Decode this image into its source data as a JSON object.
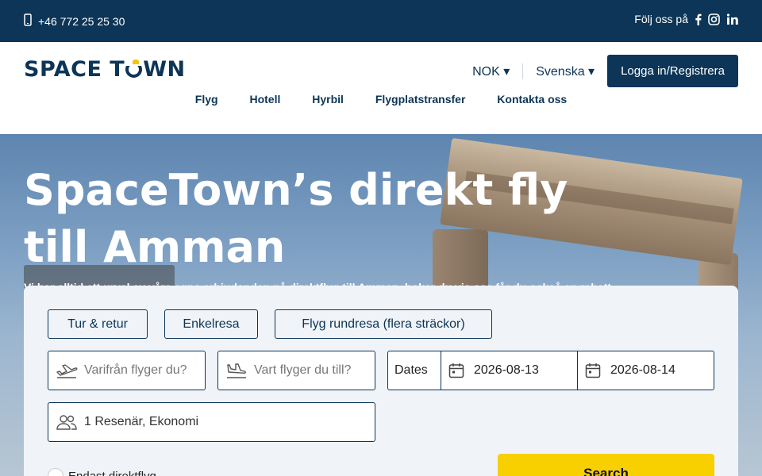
{
  "topbar": {
    "phone": "+46 772 25 25 30",
    "follow_label": "Följ oss på",
    "social_icons": [
      "facebook-icon",
      "instagram-icon",
      "linkedin-icon"
    ]
  },
  "header": {
    "logo": "SPACE TOWN",
    "currency": "NOK ▾",
    "language": "Svenska ▾",
    "login_label": "Logga in/Registrera"
  },
  "nav": {
    "items": [
      "Flyg",
      "Hotell",
      "Hyrbil",
      "Flygplatstransfer",
      "Kontakta oss"
    ]
  },
  "hero": {
    "title": "SpaceTown’s direkt fly till Amman",
    "subtitle": "Vi har alltid ett urval av våra egna erbjudanden på direktflyg till Amman, bokar du via oss får du också en rabatt"
  },
  "search": {
    "trip_types": [
      "Tur & retur",
      "Enkelresa",
      "Flyg rundresa (flera sträckor)"
    ],
    "from_placeholder": "Varifrån flyger du?",
    "to_placeholder": "Vart flyger du till?",
    "dates_label": "Dates",
    "depart_date": "2026-08-13",
    "return_date": "2026-08-14",
    "passengers": "1 Resenär, Ekonomi",
    "direct_only_label": "Endast direktflyg",
    "search_label": "Search"
  },
  "colors": {
    "brand_navy": "#0c3557",
    "accent_yellow": "#f8d000"
  }
}
